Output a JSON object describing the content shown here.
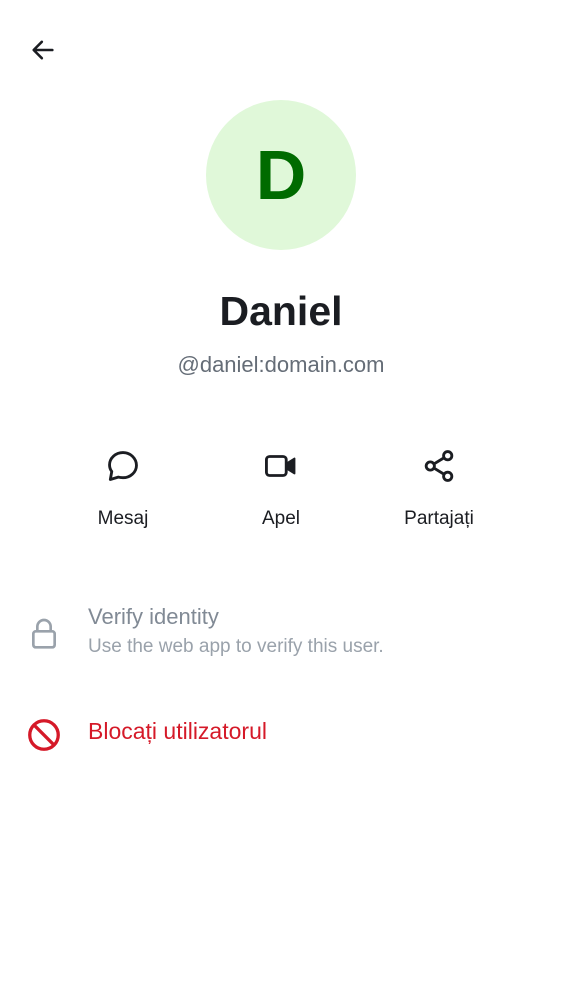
{
  "header": {
    "back_icon": "arrow-left-icon"
  },
  "profile": {
    "avatar_letter": "D",
    "avatar_bg": "#e0f8d9",
    "avatar_fg": "#006b00",
    "display_name": "Daniel",
    "user_id": "@daniel:domain.com"
  },
  "actions": [
    {
      "label": "Mesaj",
      "icon": "chat-bubble-icon"
    },
    {
      "label": "Apel",
      "icon": "video-camera-icon"
    },
    {
      "label": "Partajați",
      "icon": "share-icon"
    }
  ],
  "verify": {
    "title": "Verify identity",
    "subtitle": "Use the web app to verify this user.",
    "icon": "lock-icon"
  },
  "block": {
    "label": "Blocați utilizatorul",
    "icon": "block-icon",
    "color": "#d51928"
  }
}
